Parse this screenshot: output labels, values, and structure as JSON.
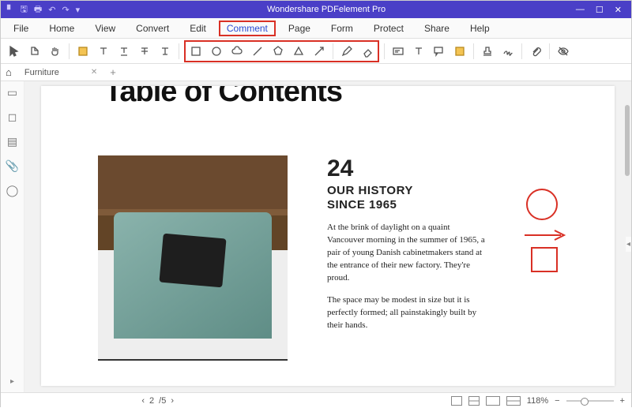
{
  "app": {
    "title": "Wondershare PDFelement Pro"
  },
  "menubar": {
    "items": [
      "File",
      "Home",
      "View",
      "Convert",
      "Edit",
      "Comment",
      "Page",
      "Form",
      "Protect",
      "Share",
      "Help"
    ],
    "active": "Comment"
  },
  "tab": {
    "name": "Furniture"
  },
  "document": {
    "title_visible": "Table of Contents",
    "section": {
      "number": "24",
      "heading_line1": "OUR HISTORY",
      "heading_line2": "SINCE 1965",
      "para1": "At the brink of daylight on a quaint Vancouver morning in the summer of 1965, a pair of young Danish cabinetmakers stand at the entrance of their new factory. They're proud.",
      "para2": "The space may be modest in size but it is perfectly formed; all painstakingly built by their hands."
    }
  },
  "annotations": {
    "shapes": [
      "circle",
      "arrow",
      "square"
    ],
    "color": "#d93025"
  },
  "status": {
    "page_current": "2",
    "page_total": "/5",
    "zoom": "118%"
  }
}
